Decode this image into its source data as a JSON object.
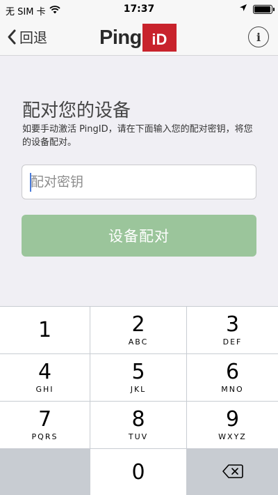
{
  "status_bar": {
    "carrier": "无 SIM 卡",
    "time": "17:37",
    "icons": [
      "wifi-icon",
      "location-arrow-icon",
      "battery-icon"
    ],
    "battery_level": 0.95
  },
  "nav": {
    "back_label": "回退",
    "logo_text": "Ping",
    "logo_box_text": "iD",
    "info_label": "i"
  },
  "main": {
    "title": "配对您的设备",
    "instructions": "如要手动激活 PingID，请在下面输入您的配对密钥，将您的设备配对。",
    "key_input": {
      "placeholder": "配对密钥",
      "value": ""
    },
    "pair_button": "设备配对"
  },
  "keypad": {
    "keys": [
      {
        "digit": "1",
        "letters": ""
      },
      {
        "digit": "2",
        "letters": "ABC"
      },
      {
        "digit": "3",
        "letters": "DEF"
      },
      {
        "digit": "4",
        "letters": "GHI"
      },
      {
        "digit": "5",
        "letters": "JKL"
      },
      {
        "digit": "6",
        "letters": "MNO"
      },
      {
        "digit": "7",
        "letters": "PQRS"
      },
      {
        "digit": "8",
        "letters": "TUV"
      },
      {
        "digit": "9",
        "letters": "WXYZ"
      },
      {
        "digit": "0",
        "letters": ""
      }
    ],
    "delete_icon": "backspace-icon"
  },
  "colors": {
    "brand_red": "#c8232c",
    "button_green": "#9bc59b",
    "background": "#f0eff4"
  }
}
